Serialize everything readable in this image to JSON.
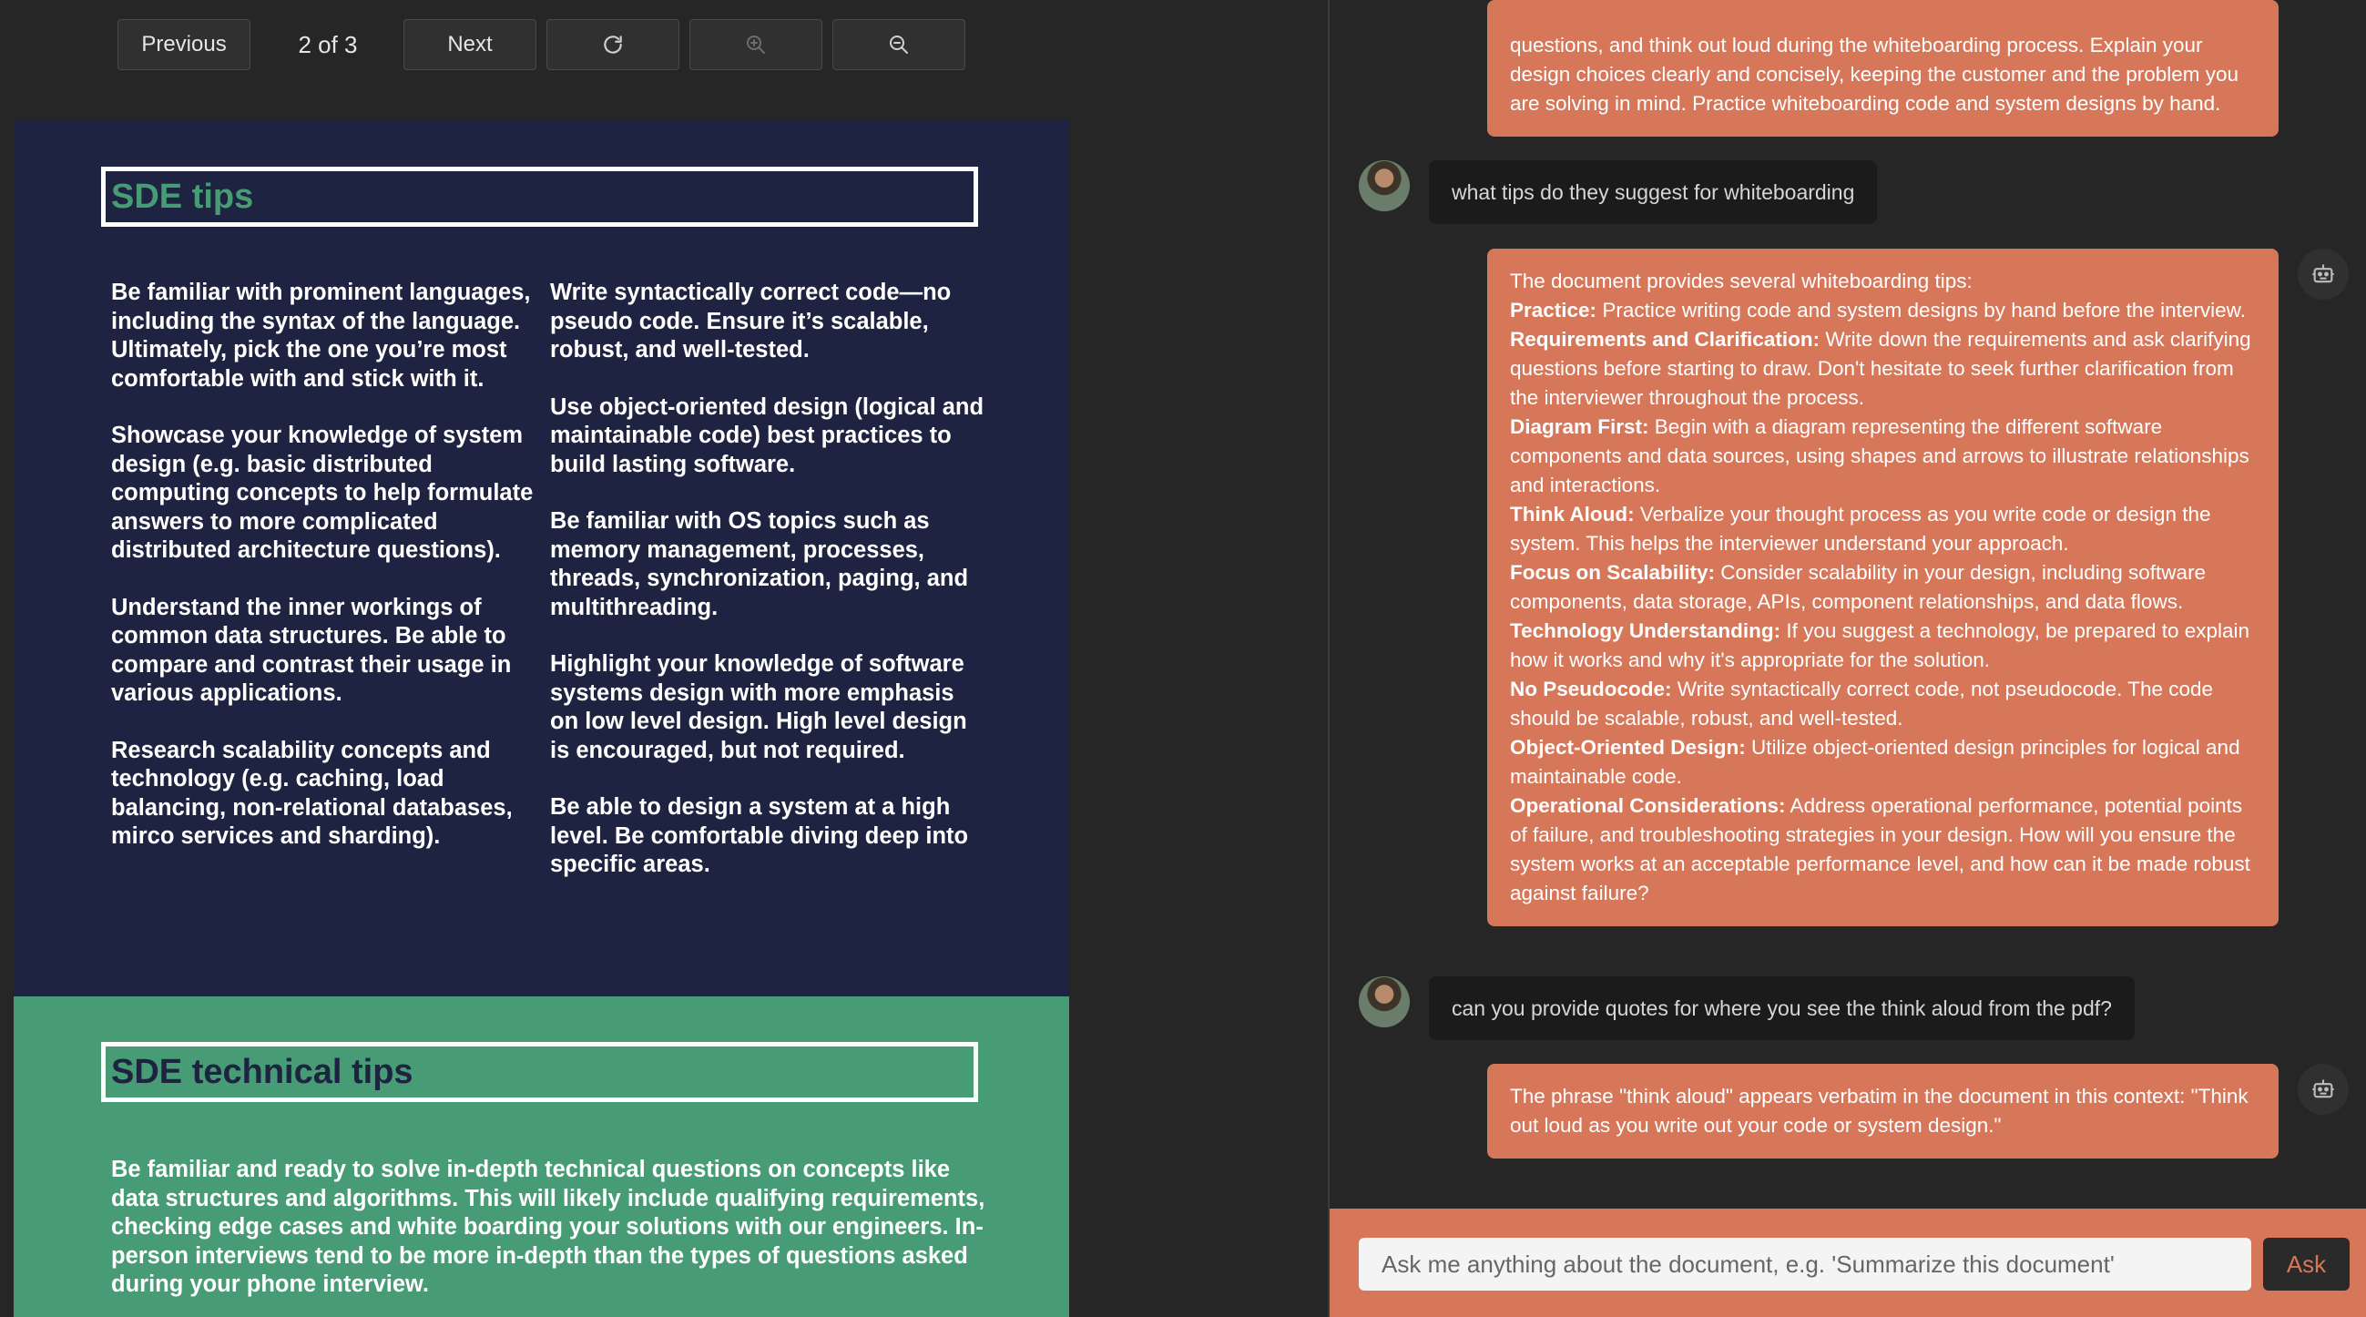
{
  "toolbar": {
    "previous_label": "Previous",
    "page_indicator": "2 of 3",
    "next_label": "Next",
    "rotate_icon": "refresh-icon",
    "zoom_in_icon": "zoom-in-icon",
    "zoom_out_icon": "zoom-out-icon"
  },
  "document": {
    "section1": {
      "title": "SDE  tips",
      "left_paragraphs": [
        "Be familiar with prominent languages, including the syntax of the language. Ultimately, pick the one you’re most comfortable with and stick with it.",
        "Showcase your knowledge of system design (e.g. basic distributed computing concepts to help formulate answers to more complicated distributed architecture questions).",
        "Understand the inner workings of common data structures. Be able to compare and contrast their usage in various applications.",
        "Research scalability concepts and technology (e.g. caching, load balancing, non-relational databases, mirco services and sharding)."
      ],
      "right_paragraphs": [
        "Write syntactically correct code—no pseudo code. Ensure it’s scalable, robust, and well-tested.",
        "Use object-oriented design (logical and maintainable code) best practices to build lasting software.",
        "Be familiar with OS topics such as memory management, processes, threads, synchronization, paging, and multithreading.",
        "Highlight your knowledge of software systems design with more emphasis on low level design. High level design is encouraged, but not required.",
        "Be able to design a system at a high level. Be comfortable diving deep into specific areas."
      ]
    },
    "section2": {
      "title": "SDE technical tips",
      "body": "Be familiar and ready to solve in-depth technical questions on concepts like data structures and algorithms. This will likely include qualifying requirements, checking edge cases and white boarding your solutions with our engineers. In-person interviews tend to be more in-depth than the types of questions asked during your phone interview."
    }
  },
  "chat": {
    "top_bot_text": "questions, and think out loud during the whiteboarding process. Explain your design choices clearly and concisely, keeping the customer and the problem you are solving in mind. Practice whiteboarding code and system designs by hand.",
    "user_message_1": "what tips do they suggest for whiteboarding",
    "bot_reply_1": {
      "intro": "The document provides several whiteboarding tips:",
      "tips": [
        {
          "label": "Practice:",
          "text": " Practice writing code and system designs by hand before the interview."
        },
        {
          "label": "Requirements and Clarification:",
          "text": " Write down the requirements and ask clarifying questions before starting to draw. Don't hesitate to seek further clarification from the interviewer throughout the process."
        },
        {
          "label": "Diagram First:",
          "text": " Begin with a diagram representing the different software components and data sources, using shapes and arrows to illustrate relationships and interactions."
        },
        {
          "label": "Think Aloud:",
          "text": " Verbalize your thought process as you write code or design the system. This helps the interviewer understand your approach."
        },
        {
          "label": "Focus on Scalability:",
          "text": " Consider scalability in your design, including software components, data storage, APIs, component relationships, and data flows."
        },
        {
          "label": "Technology Understanding:",
          "text": " If you suggest a technology, be prepared to explain how it works and why it's appropriate for the solution."
        },
        {
          "label": "No Pseudocode:",
          "text": " Write syntactically correct code, not pseudocode. The code should be scalable, robust, and well-tested."
        },
        {
          "label": "Object-Oriented Design:",
          "text": " Utilize object-oriented design principles for logical and maintainable code."
        },
        {
          "label": "Operational Considerations:",
          "text": " Address operational performance, potential points of failure, and troubleshooting strategies in your design. How will you ensure the system works at an acceptable performance level, and how can it be made robust against failure?"
        }
      ]
    },
    "user_message_2": "can you provide quotes for where you see the think aloud from the pdf?",
    "bot_reply_2": "The phrase \"think aloud\" appears verbatim in the document in this context: \"Think out loud as you write out your code or system design.\"",
    "input_placeholder": "Ask me anything about the document, e.g. 'Summarize this document'",
    "ask_label": "Ask",
    "bot_icon": "robot-icon",
    "user_avatar": "user-avatar"
  },
  "colors": {
    "accent": "#d7775a",
    "doc_navy": "#1d2340",
    "doc_green": "#479c75"
  }
}
